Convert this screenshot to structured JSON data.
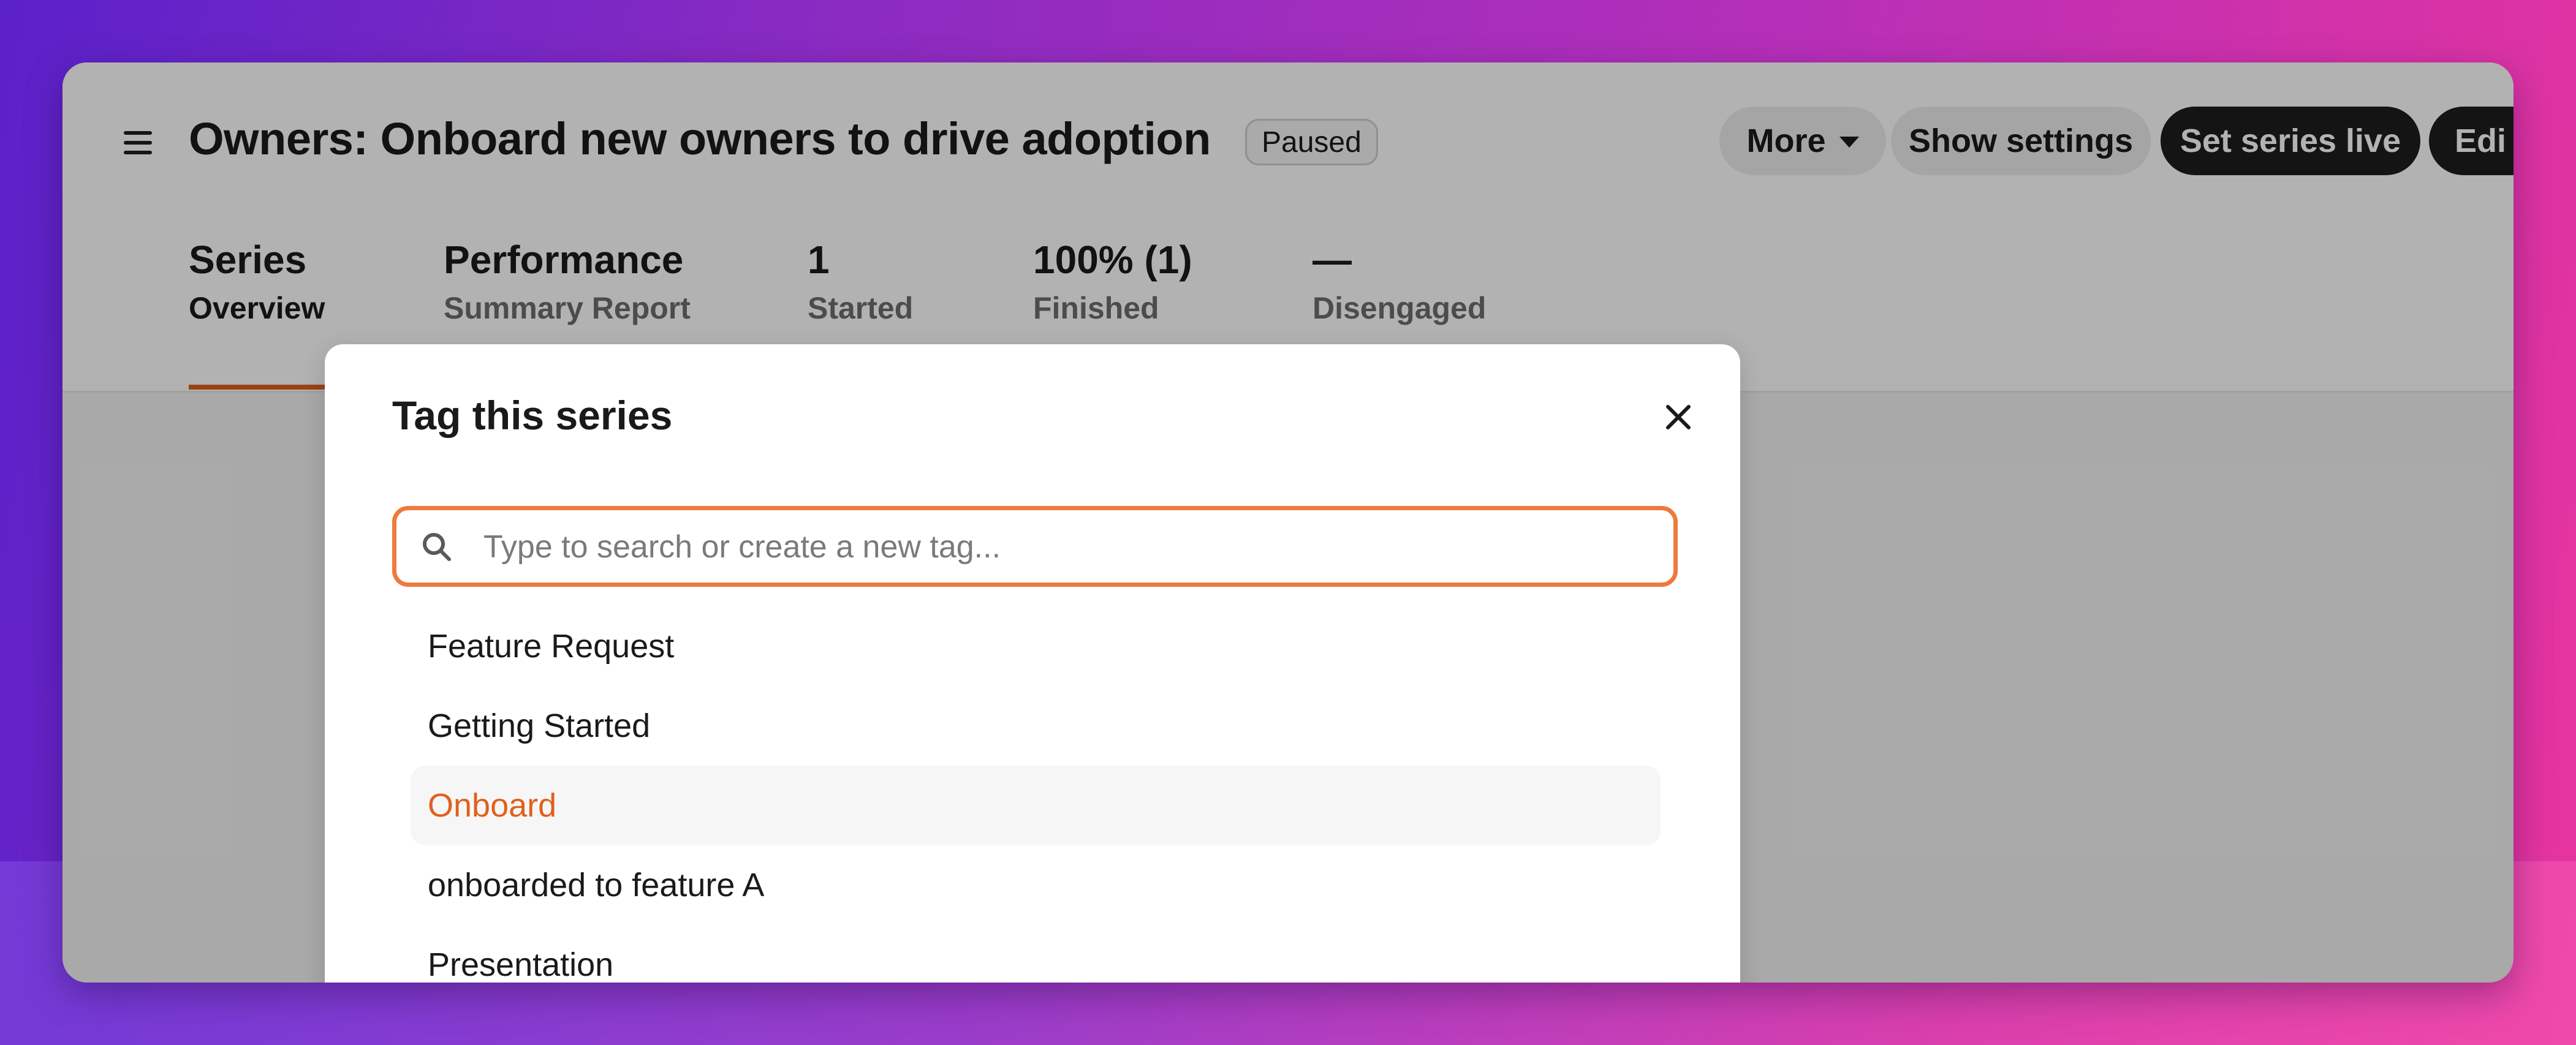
{
  "header": {
    "title": "Owners: Onboard new owners to drive adoption",
    "status": "Paused",
    "buttons": {
      "more": "More",
      "show_settings": "Show settings",
      "set_live": "Set series live",
      "edit": "Edi"
    }
  },
  "tabs": [
    {
      "value": "Series",
      "label": "Overview",
      "active": true
    },
    {
      "value": "Performance",
      "label": "Summary Report"
    },
    {
      "value": "1",
      "label": "Started"
    },
    {
      "value": "100% (1)",
      "label": "Finished"
    },
    {
      "value": "—",
      "label": "Disengaged"
    }
  ],
  "modal": {
    "title": "Tag this series",
    "search": {
      "placeholder": "Type to search or create a new tag...",
      "value": ""
    },
    "tags": [
      "Feature Request",
      "Getting Started",
      "Onboard",
      "onboarded to feature A",
      "Presentation"
    ],
    "highlighted_tag": "Onboard"
  },
  "colors": {
    "accent": "#e0601d",
    "focus_border": "#ee7a3d",
    "primary_button": "#1d1d1d"
  },
  "icons": {
    "menu": "hamburger-menu-icon",
    "more_caret": "caret-down-icon",
    "close": "close-icon",
    "search": "search-icon"
  }
}
